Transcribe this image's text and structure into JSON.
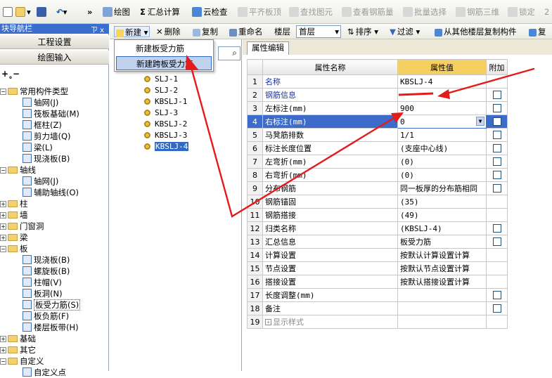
{
  "toolbar": {
    "chevron": "»",
    "draw": "绘图",
    "sum_calc": "汇总计算",
    "cloud_check": "云检查",
    "flush_top": "平齐板顶",
    "find_element": "查找图元",
    "view_rebar": "查看钢筋量",
    "batch_select": "批量选择",
    "rebar_3d": "钢筋三维",
    "lock": "锁定",
    "cut": "2"
  },
  "nav": {
    "title": "块导航栏",
    "pin": "ㄗ x",
    "project_settings": "工程设置",
    "draw_input": "绘图输入",
    "tree": [
      {
        "label": "常用构件类型",
        "level": 0,
        "expanded": true,
        "folder": true
      },
      {
        "label": "轴网(J)",
        "level": 1,
        "icon": "grid-icon"
      },
      {
        "label": "筏板基础(M)",
        "level": 1,
        "icon": "raft-foundation-icon"
      },
      {
        "label": "框柱(Z)",
        "level": 1,
        "icon": "column-icon"
      },
      {
        "label": "剪力墙(Q)",
        "level": 1,
        "icon": "shear-wall-icon"
      },
      {
        "label": "梁(L)",
        "level": 1,
        "icon": "beam-icon"
      },
      {
        "label": "现浇板(B)",
        "level": 1,
        "icon": "slab-icon"
      },
      {
        "label": "轴线",
        "level": 0,
        "expanded": true,
        "folder": true
      },
      {
        "label": "轴网(J)",
        "level": 1,
        "icon": "grid-icon"
      },
      {
        "label": "辅助轴线(O)",
        "level": 1,
        "icon": "aux-axis-icon"
      },
      {
        "label": "柱",
        "level": 0,
        "expanded": false,
        "folder": true
      },
      {
        "label": "墙",
        "level": 0,
        "expanded": false,
        "folder": true
      },
      {
        "label": "门窗洞",
        "level": 0,
        "expanded": false,
        "folder": true
      },
      {
        "label": "梁",
        "level": 0,
        "expanded": false,
        "folder": true
      },
      {
        "label": "板",
        "level": 0,
        "expanded": true,
        "folder": true
      },
      {
        "label": "现浇板(B)",
        "level": 1,
        "icon": "slab-icon"
      },
      {
        "label": "螺旋板(B)",
        "level": 1,
        "icon": "spiral-slab-icon"
      },
      {
        "label": "柱帽(V)",
        "level": 1,
        "icon": "column-cap-icon"
      },
      {
        "label": "板洞(N)",
        "level": 1,
        "icon": "slab-hole-icon"
      },
      {
        "label": "板受力筋(S)",
        "level": 1,
        "icon": "slab-rebar-icon",
        "selected": true
      },
      {
        "label": "板负筋(F)",
        "level": 1,
        "icon": "neg-rebar-icon"
      },
      {
        "label": "楼层板带(H)",
        "level": 1,
        "icon": "slab-band-icon"
      },
      {
        "label": "基础",
        "level": 0,
        "expanded": false,
        "folder": true
      },
      {
        "label": "其它",
        "level": 0,
        "expanded": false,
        "folder": true
      },
      {
        "label": "自定义",
        "level": 0,
        "expanded": true,
        "folder": true
      },
      {
        "label": "自定义点",
        "level": 1,
        "icon": "custom-point-icon"
      }
    ]
  },
  "toolbar2": {
    "new": "新建",
    "delete": "删除",
    "copy": "复制",
    "rename": "重命名",
    "floor_label": "楼层",
    "floor_value": "首层",
    "sort": "排序",
    "filter": "过滤",
    "copy_from_floor": "从其他楼层复制构件",
    "last": "复"
  },
  "new_menu": {
    "item1": "新建板受力筋",
    "item2": "新建跨板受力筋"
  },
  "components": [
    "SLJ-1",
    "SLJ-2",
    "KBSLJ-1",
    "SLJ-3",
    "KBSLJ-2",
    "KBSLJ-3",
    "KBSLJ-4"
  ],
  "property_panel": {
    "tab": "属性编辑",
    "headers": {
      "name": "属性名称",
      "value": "属性值",
      "extra": "附加"
    },
    "rows": [
      {
        "no": "1",
        "name": "名称",
        "value": "KBSLJ-4",
        "check": false,
        "blue": true
      },
      {
        "no": "2",
        "name": "钢筋信息",
        "value": "",
        "check": true,
        "blue": true
      },
      {
        "no": "3",
        "name": "左标注(mm)",
        "value": "900",
        "check": true
      },
      {
        "no": "4",
        "name": "右标注(mm)",
        "value": "0",
        "check": true,
        "selected": true
      },
      {
        "no": "5",
        "name": "马凳筋排数",
        "value": "1/1",
        "check": true
      },
      {
        "no": "6",
        "name": "标注长度位置",
        "value": "(支座中心线)",
        "check": true
      },
      {
        "no": "7",
        "name": "左弯折(mm)",
        "value": "(0)",
        "check": true
      },
      {
        "no": "8",
        "name": "右弯折(mm)",
        "value": "(0)",
        "check": true
      },
      {
        "no": "9",
        "name": "分布钢筋",
        "value": "同一板厚的分布筋相同",
        "check": true
      },
      {
        "no": "10",
        "name": "钢筋锚固",
        "value": "(35)",
        "check": false
      },
      {
        "no": "11",
        "name": "钢筋搭接",
        "value": "(49)",
        "check": false
      },
      {
        "no": "12",
        "name": "归类名称",
        "value": "(KBSLJ-4)",
        "check": true
      },
      {
        "no": "13",
        "name": "汇总信息",
        "value": "板受力筋",
        "check": true
      },
      {
        "no": "14",
        "name": "计算设置",
        "value": "按默认计算设置计算",
        "check": false
      },
      {
        "no": "15",
        "name": "节点设置",
        "value": "按默认节点设置计算",
        "check": false
      },
      {
        "no": "16",
        "name": "搭接设置",
        "value": "按默认搭接设置计算",
        "check": false
      },
      {
        "no": "17",
        "name": "长度调整(mm)",
        "value": "",
        "check": true
      },
      {
        "no": "18",
        "name": "备注",
        "value": "",
        "check": true
      },
      {
        "no": "19",
        "name": "显示样式",
        "value": "",
        "check": null,
        "expander": true
      }
    ]
  },
  "colors": {
    "accent_blue": "#3c6bc9",
    "header_highlight": "#f6cf63",
    "annotation_red": "#e31b1b"
  }
}
